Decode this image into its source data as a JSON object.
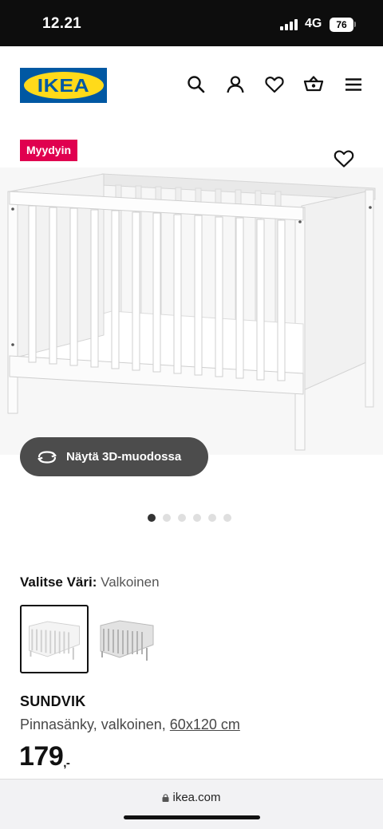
{
  "status_bar": {
    "time": "12.21",
    "network": "4G",
    "battery": "76"
  },
  "header": {
    "logo_text": "IKEA",
    "icons": [
      "search-icon",
      "user-icon",
      "heart-icon",
      "cart-icon",
      "menu-icon"
    ]
  },
  "product": {
    "badge": "Myydyin",
    "view_3d_label": "Näytä 3D-muodossa",
    "gallery_count": 6,
    "gallery_active": 1,
    "color_label": "Valitse Väri:",
    "color_value": "Valkoinen",
    "name": "SUNDVIK",
    "description": "Pinnasänky, valkoinen,",
    "size": "60x120 cm",
    "price": "179",
    "price_suffix": ",-"
  },
  "browser": {
    "url": "ikea.com"
  },
  "colors": {
    "ikea_blue": "#0058a3",
    "ikea_yellow": "#ffda1a",
    "badge": "#e0004f",
    "button_dark": "#4c4c4c"
  }
}
